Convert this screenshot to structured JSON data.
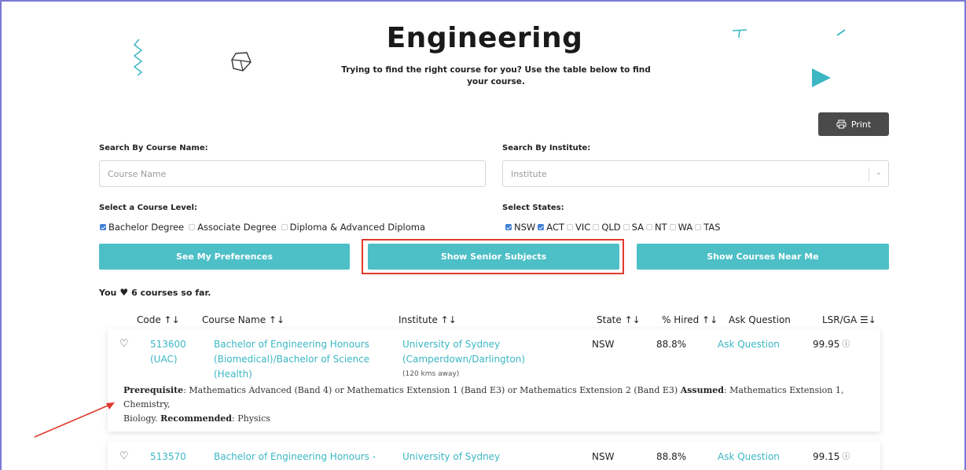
{
  "header": {
    "title": "Engineering",
    "subtitle": "Trying to find the right course for you? Use the table below to find your course."
  },
  "toolbar": {
    "print_label": "Print"
  },
  "search": {
    "course_label": "Search By Course Name:",
    "course_placeholder": "Course Name",
    "institute_label": "Search By Institute:",
    "institute_placeholder": "Institute"
  },
  "levels": {
    "label": "Select a Course Level:",
    "options": [
      {
        "label": "Bachelor Degree",
        "checked": true
      },
      {
        "label": "Associate Degree",
        "checked": false
      },
      {
        "label": "Diploma & Advanced Diploma",
        "checked": false
      }
    ]
  },
  "states": {
    "label": "Select States:",
    "options": [
      {
        "label": "NSW",
        "checked": true
      },
      {
        "label": "ACT",
        "checked": true
      },
      {
        "label": "VIC",
        "checked": false
      },
      {
        "label": "QLD",
        "checked": false
      },
      {
        "label": "SA",
        "checked": false
      },
      {
        "label": "NT",
        "checked": false
      },
      {
        "label": "WA",
        "checked": false
      },
      {
        "label": "TAS",
        "checked": false
      }
    ]
  },
  "actions": {
    "preferences": "See My Preferences",
    "senior_subjects": "Show Senior Subjects",
    "courses_near": "Show Courses Near Me"
  },
  "favourites": {
    "prefix": "You",
    "suffix": "6 courses so far."
  },
  "table": {
    "headers": {
      "code": "Code ↑↓",
      "course": "Course Name ↑↓",
      "institute": "Institute ↑↓",
      "state": "State ↑↓",
      "hired": "% Hired ↑↓",
      "ask": "Ask Question",
      "lsr": "LSR/GA ☰↓"
    },
    "rows": [
      {
        "code1": "513600",
        "code2": "(UAC)",
        "course1": "Bachelor of Engineering Honours",
        "course2": "(Biomedical)/Bachelor of Science",
        "course3": "(Health)",
        "inst1": "University of Sydney",
        "inst2": "(Camperdown/Darlington)",
        "distance": "(120 kms away)",
        "state": "NSW",
        "hired": "88.8%",
        "ask": "Ask Question",
        "lsr": "99.95",
        "prereq_label": "Prerequisite",
        "prereq": ": Mathematics Advanced (Band 4) or Mathematics Extension 1 (Band E3) or Mathematics Extension 2 (Band E3) ",
        "assumed_label": "Assumed",
        "assumed": ": Mathematics Extension 1, Chemistry,",
        "assumed2": "Biology. ",
        "recommended_label": "Recommended",
        "recommended": ": Physics"
      },
      {
        "code1": "513570",
        "course1": "Bachelor of Engineering Honours -",
        "inst1": "University of Sydney",
        "state": "NSW",
        "hired": "88.8%",
        "ask": "Ask Question",
        "lsr": "99.15"
      }
    ]
  },
  "colors": {
    "teal": "#4dbfc6",
    "link": "#3bb7c4",
    "highlight": "#e03a2d",
    "checkbox": "#3f7fd6"
  }
}
